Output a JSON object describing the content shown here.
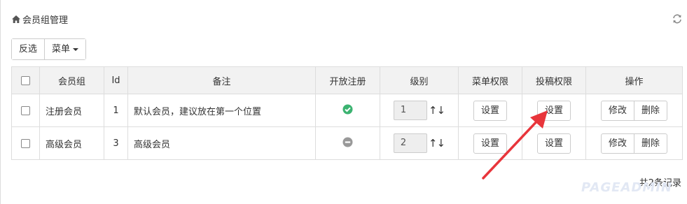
{
  "header": {
    "title": "会员组管理",
    "home_icon": "home-icon",
    "refresh_icon": "refresh-icon"
  },
  "toolbar": {
    "invert_label": "反选",
    "menu_label": "菜单"
  },
  "table": {
    "columns": [
      "会员组",
      "Id",
      "备注",
      "开放注册",
      "级别",
      "菜单权限",
      "投稿权限",
      "操作"
    ],
    "rows": [
      {
        "name": "注册会员",
        "id": "1",
        "note": "默认会员，建议放在第一个位置",
        "open_register": true,
        "level": "1",
        "menu_perm": "设置",
        "submit_perm": "设置",
        "edit": "修改",
        "delete": "删除"
      },
      {
        "name": "高级会员",
        "id": "3",
        "note": "高级会员",
        "open_register": false,
        "level": "2",
        "menu_perm": "设置",
        "submit_perm": "设置",
        "edit": "修改",
        "delete": "删除"
      }
    ],
    "arrows": "↑↓"
  },
  "footer": {
    "count_text": "共2条记录"
  },
  "watermark": "PAGEADMIN",
  "colors": {
    "status_open": "#3cb371",
    "status_closed": "#999999",
    "annotation_arrow": "#e8353b"
  }
}
